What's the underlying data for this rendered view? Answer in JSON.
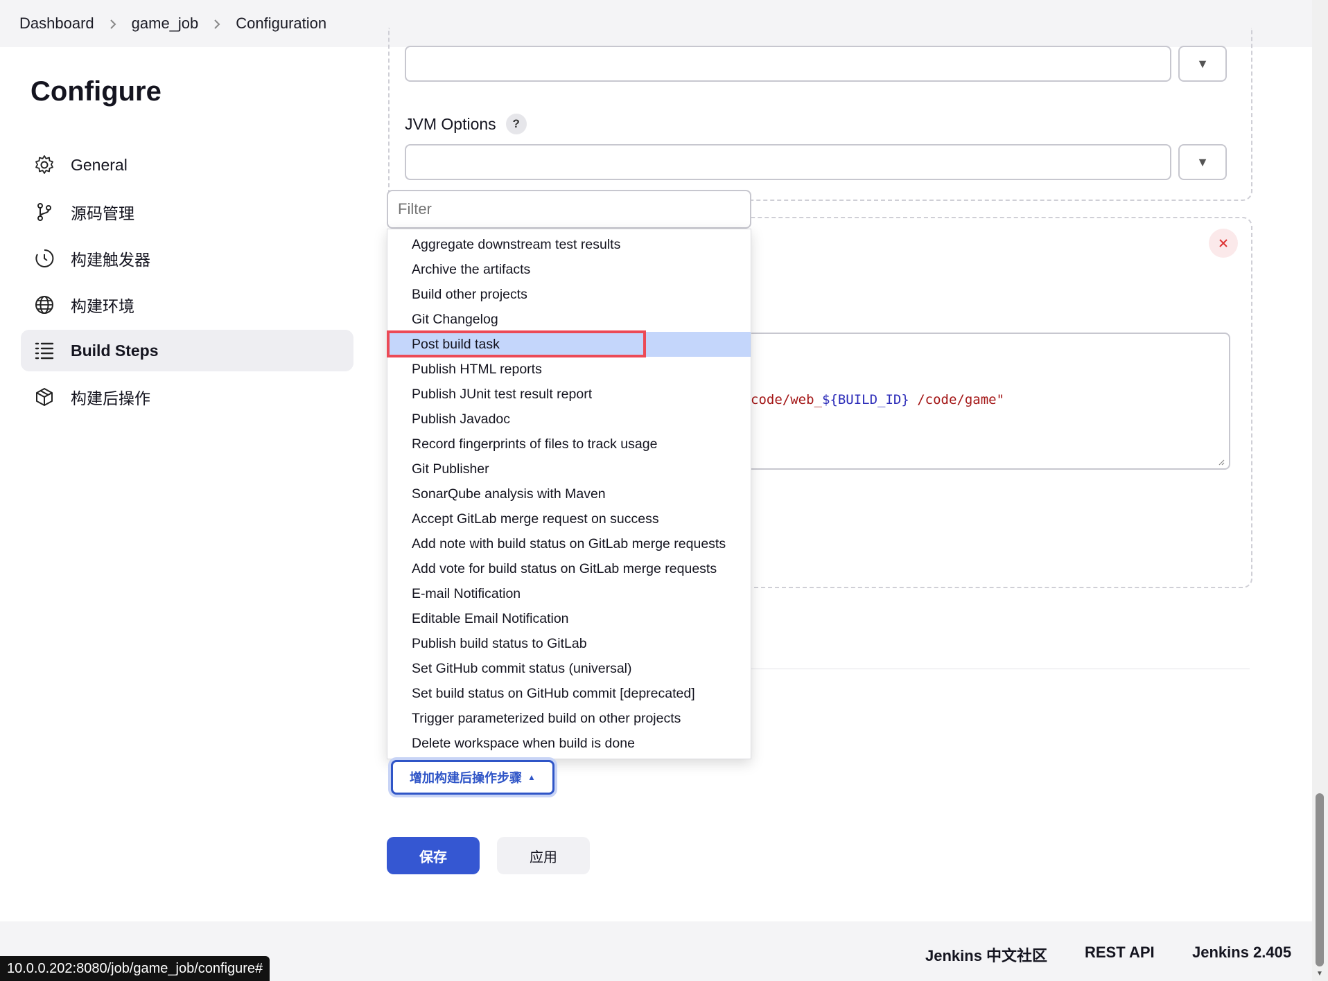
{
  "breadcrumb": {
    "items": [
      "Dashboard",
      "game_job",
      "Configuration"
    ]
  },
  "sidebar": {
    "title": "Configure",
    "items": [
      {
        "label": "General",
        "icon": "gear-icon"
      },
      {
        "label": "源码管理",
        "icon": "branch-icon"
      },
      {
        "label": "构建触发器",
        "icon": "clock-icon"
      },
      {
        "label": "构建环境",
        "icon": "globe-icon"
      },
      {
        "label": "Build Steps",
        "icon": "list-icon",
        "active": true
      },
      {
        "label": "构建后操作",
        "icon": "package-icon"
      }
    ]
  },
  "form": {
    "jvm_label": "JVM Options",
    "help_glyph": "?",
    "code_prefix": "code/web_",
    "code_var": "${BUILD_ID}",
    "code_suffix": " /code/game\""
  },
  "filter": {
    "placeholder": "Filter"
  },
  "menu": {
    "items": [
      "Aggregate downstream test results",
      "Archive the artifacts",
      "Build other projects",
      "Git Changelog",
      "Post build task",
      "Publish HTML reports",
      "Publish JUnit test result report",
      "Publish Javadoc",
      "Record fingerprints of files to track usage",
      "Git Publisher",
      "SonarQube analysis with Maven",
      "Accept GitLab merge request on success",
      "Add note with build status on GitLab merge requests",
      "Add vote for build status on GitLab merge requests",
      "E-mail Notification",
      "Editable Email Notification",
      "Publish build status to GitLab",
      "Set GitHub commit status (universal)",
      "Set build status on GitHub commit [deprecated]",
      "Trigger parameterized build on other projects",
      "Delete workspace when build is done"
    ],
    "highlighted_index": 4
  },
  "buttons": {
    "add_post_build_step": "增加构建后操作步骤",
    "save": "保存",
    "apply": "应用"
  },
  "footer": {
    "community": "Jenkins 中文社区",
    "rest_api": "REST API",
    "version": "Jenkins 2.405"
  },
  "status_url": "10.0.0.202:8080/job/game_job/configure#",
  "colors": {
    "accent": "#3557d2",
    "highlight": "#c4d6fb",
    "annotation_box": "#ec4a56"
  }
}
